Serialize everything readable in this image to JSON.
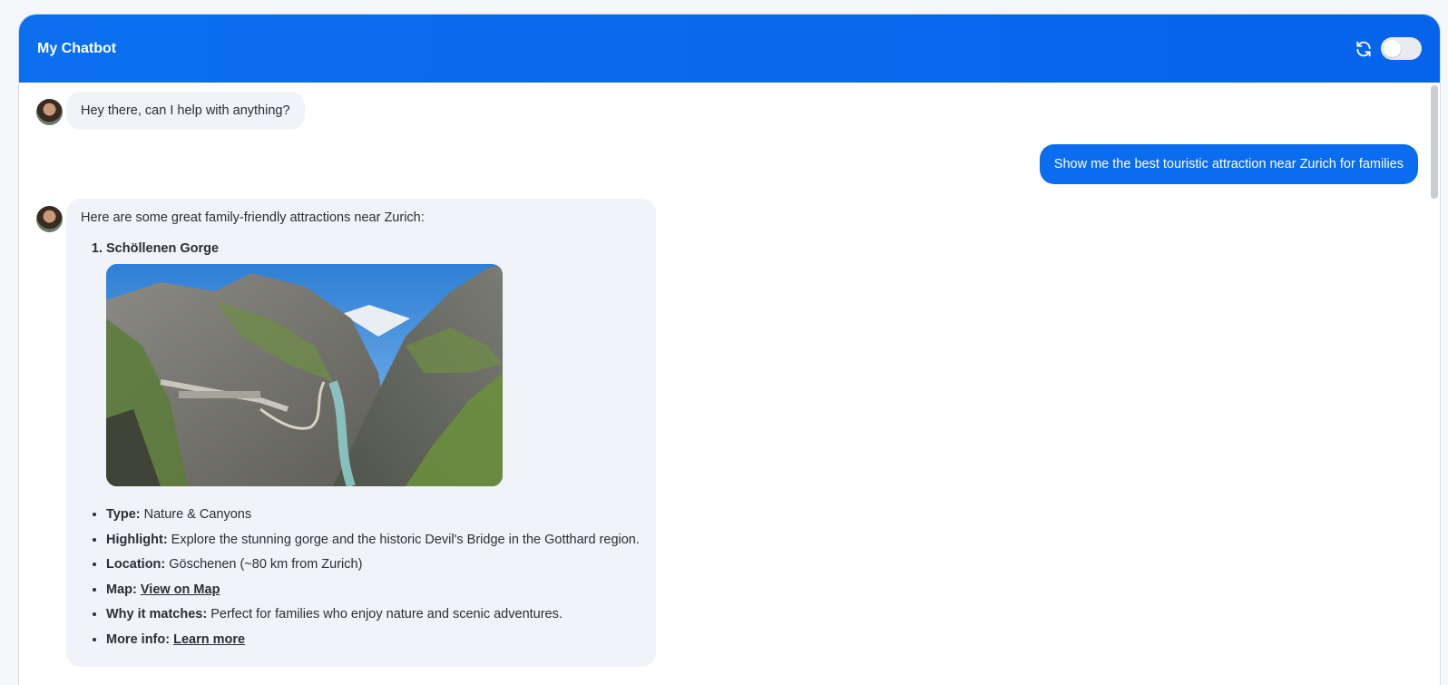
{
  "header": {
    "title": "My Chatbot"
  },
  "messages": {
    "greeting": "Hey there, can I help with anything?",
    "user_query": "Show me the best touristic attraction near Zurich for families",
    "reply_intro": "Here are some great family-friendly attractions near Zurich:",
    "attraction": {
      "name": "Schöllenen Gorge",
      "type_label": "Type:",
      "type_value": " Nature & Canyons",
      "highlight_label": "Highlight:",
      "highlight_value": " Explore the stunning gorge and the historic Devil's Bridge in the Gotthard region.",
      "location_label": "Location:",
      "location_value": " Göschenen (~80 km from Zurich)",
      "map_label": "Map:",
      "map_link": "View on Map",
      "why_label": "Why it matches:",
      "why_value": " Perfect for families who enjoy nature and scenic adventures.",
      "more_label": "More info:",
      "more_link": "Learn more"
    }
  },
  "colors": {
    "header_blue": "#0b6ff0",
    "user_bubble": "#0a6cef",
    "bot_bubble": "#f0f3f7"
  },
  "icons": {
    "refresh": "refresh-icon",
    "avatar": "bot-avatar"
  }
}
